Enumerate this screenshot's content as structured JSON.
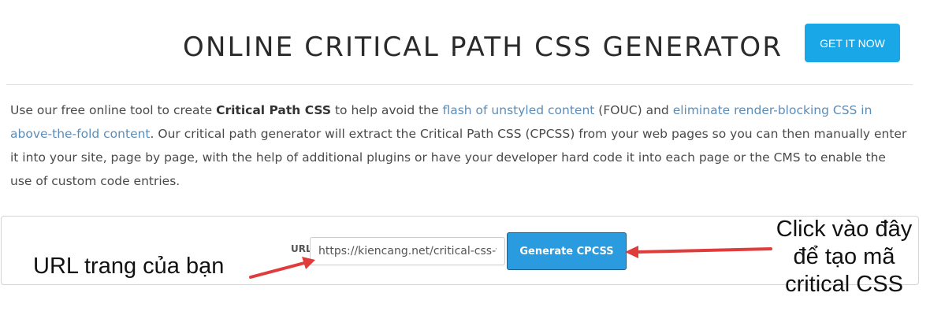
{
  "header": {
    "title": "ONLINE CRITICAL PATH CSS GENERATOR",
    "cta_label": "GET IT NOW"
  },
  "intro": {
    "t1": "Use our free online tool to create ",
    "bold": "Critical Path CSS",
    "t2": " to help avoid the ",
    "link1": "flash of unstyled content",
    "t3": " (FOUC) and ",
    "link2": "eliminate render-blocking CSS in above-the-fold content",
    "t4": ".  Our critical path generator will extract the Critical Path CSS (CPCSS) from your web pages so you can then manually enter it into your site, page by page, with the help of additional plugins or have your developer hard code it into each page or the CMS to enable the use of custom code entries."
  },
  "form": {
    "url_label": "URL",
    "url_value": "https://kiencang.net/critical-css-v",
    "generate_label": "Generate CPCSS"
  },
  "annotations": {
    "left_note": "URL trang của bạn",
    "right_note_line1": "Click vào đây",
    "right_note_line2": "để tạo mã",
    "right_note_line3": "critical CSS",
    "arrow_color": "#e03c3c"
  }
}
